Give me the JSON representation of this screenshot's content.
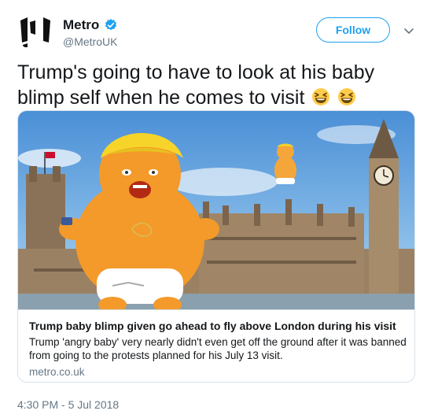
{
  "account": {
    "name": "Metro",
    "handle": "@MetroUK",
    "verified": true,
    "follow_label": "Follow"
  },
  "tweet": {
    "text": "Trump's going to have to look at his baby blimp self when he comes to visit",
    "emojis": [
      "laughing-face",
      "laughing-face"
    ],
    "timestamp": "4:30 PM - 5 Jul 2018"
  },
  "card": {
    "title": "Trump baby blimp given go ahead to fly above London during his visit",
    "description": "Trump 'angry baby' very nearly didn't even get off the ground after it was banned from going to the protests planned for his July 13 visit.",
    "domain": "metro.co.uk",
    "image_alt": "Orange baby blimp in nappy floating in front of the Houses of Parliament and Big Ben"
  },
  "colors": {
    "accent": "#1da1f2",
    "text": "#14171a",
    "secondary": "#657786",
    "border": "#d9e1e8"
  }
}
